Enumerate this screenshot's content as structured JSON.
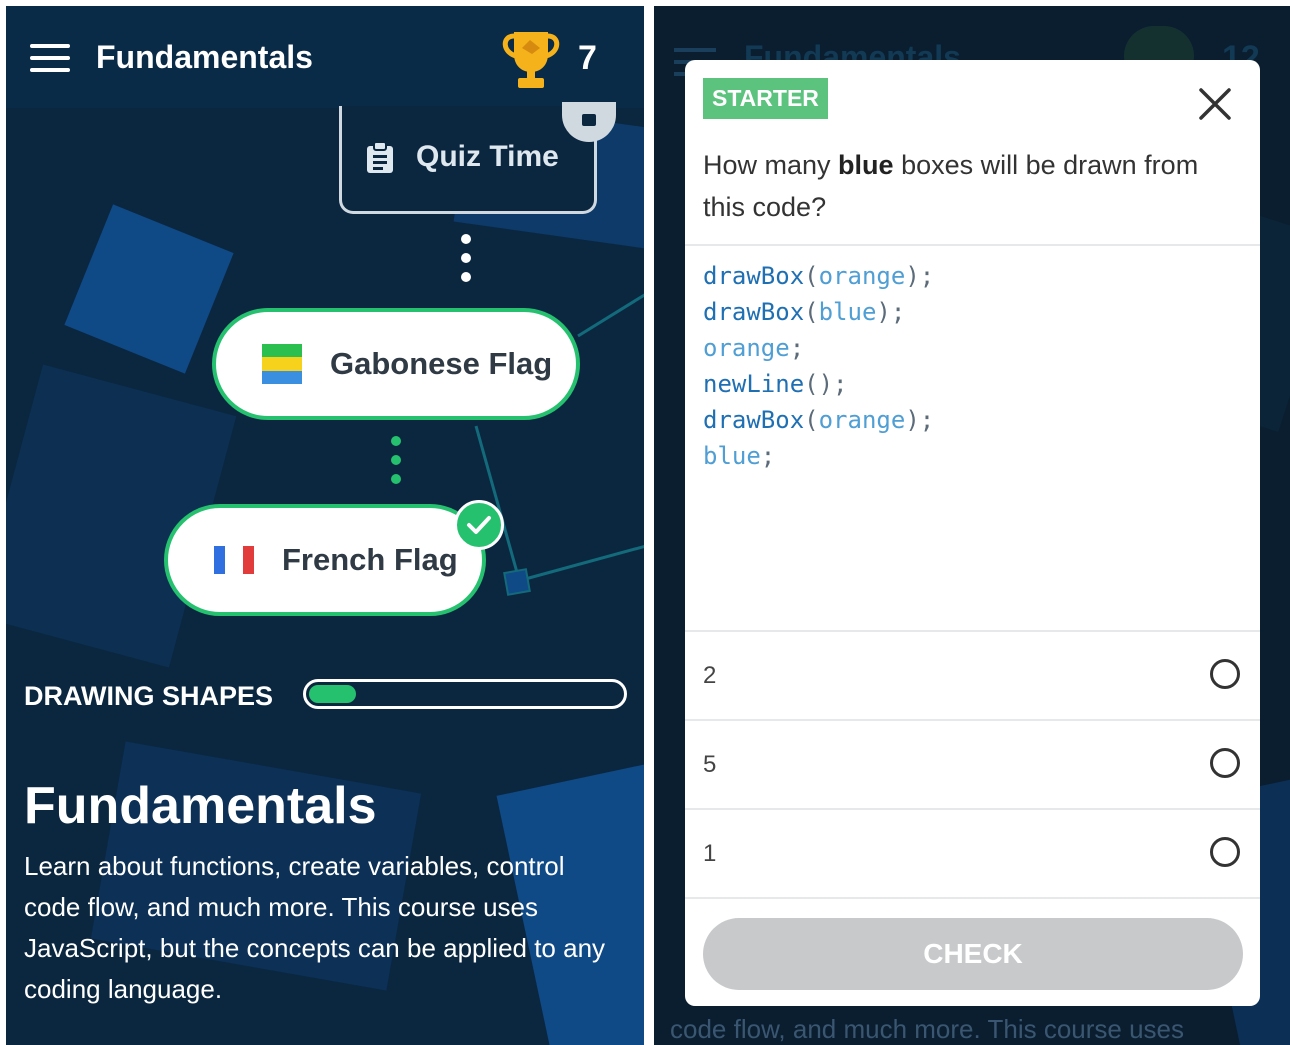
{
  "left": {
    "appbar": {
      "title": "Fundamentals",
      "trophy_count": "7"
    },
    "path": {
      "quiz_label": "Quiz Time",
      "nodes": [
        {
          "label": "Gabonese Flag"
        },
        {
          "label": "French Flag",
          "completed": true
        }
      ]
    },
    "progress": {
      "label": "DRAWING SHAPES",
      "fraction": 0.15
    },
    "course": {
      "title": "Fundamentals",
      "description": "Learn about functions, create variables, control code flow, and much more. This course uses JavaScript, but the concepts can be applied to any coding language."
    }
  },
  "right": {
    "background": {
      "title": "Fundamentals",
      "trophy_count": "12",
      "description_fragment": "code flow, and much more. This course uses"
    },
    "modal": {
      "badge": "STARTER",
      "question_prefix": "How many ",
      "question_bold": "blue",
      "question_suffix": " boxes will be drawn from this code?",
      "code_lines": [
        {
          "fn": "drawBox",
          "arg": "orange",
          "end": ");"
        },
        {
          "fn": "drawBox",
          "arg": "blue",
          "end": ");"
        },
        {
          "fn": "",
          "arg": "orange",
          "end": ";"
        },
        {
          "fn": "newLine",
          "arg": "",
          "end": "();"
        },
        {
          "fn": "drawBox",
          "arg": "orange",
          "end": ");"
        },
        {
          "fn": "",
          "arg": "blue",
          "end": ";"
        }
      ],
      "options": [
        "2",
        "5",
        "1"
      ],
      "check_label": "CHECK"
    }
  },
  "colors": {
    "background": "#0b2740",
    "accent_green": "#25c16f",
    "badge_green": "#5cc37e",
    "code_blue": "#4f9ed4",
    "button_disabled": "#c7c9cb"
  }
}
